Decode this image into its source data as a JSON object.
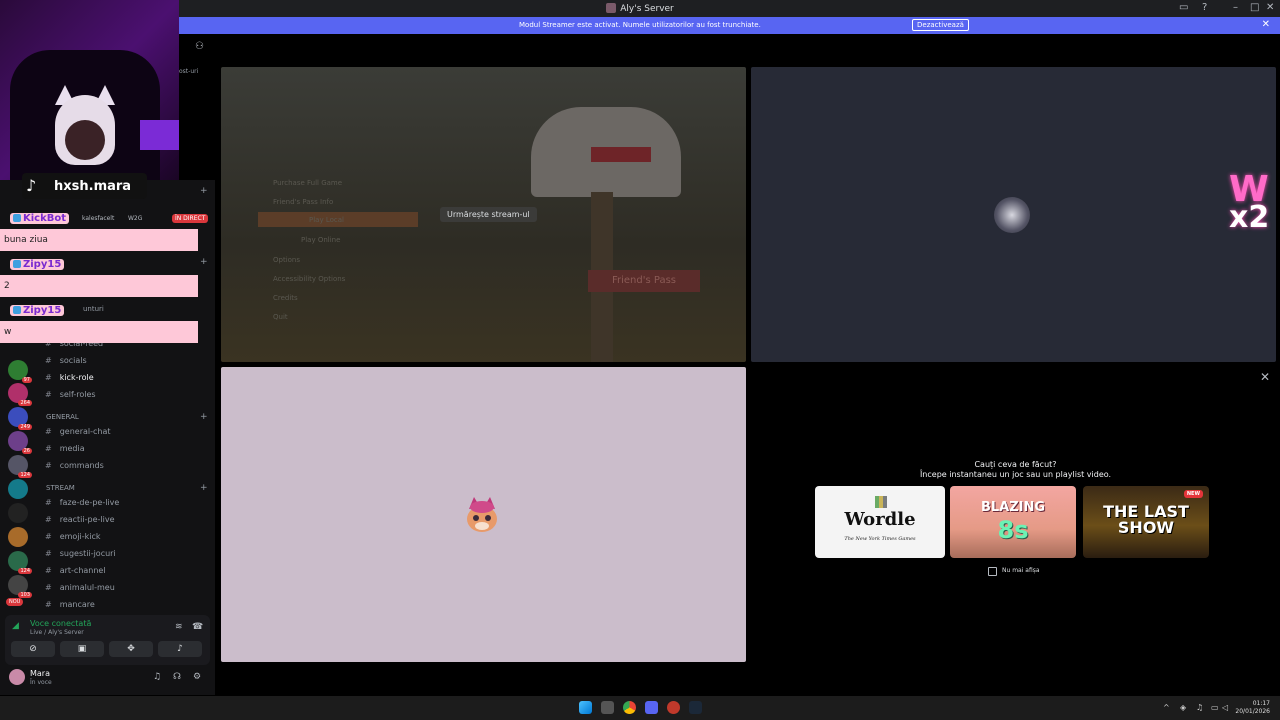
{
  "window": {
    "title": "Aly's Server"
  },
  "banner": {
    "text": "Modul Streamer este activat. Numele utilizatorilor au fost trunchiate.",
    "button": "Dezactivează"
  },
  "overlay": {
    "tiktok_handle": "hxsh.mara",
    "chat": [
      {
        "user": "KickBot",
        "message": "buna ziua"
      },
      {
        "user": "Zipy15",
        "message": "2"
      },
      {
        "user": "Zipy15",
        "message": "w"
      }
    ]
  },
  "sidebar": {
    "fragment_top": "ost-uri",
    "live_user": "kalesfacelt",
    "live_tag": "W2G",
    "live_badge": "ÎN DIRECT",
    "fragment_mid": "unturi",
    "channels_top": [
      {
        "name": "social-feed"
      },
      {
        "name": "socials"
      },
      {
        "name": "kick-role",
        "active": true
      },
      {
        "name": "self-roles"
      }
    ],
    "category_general": "GENERAL",
    "channels_general": [
      {
        "name": "general-chat"
      },
      {
        "name": "media"
      },
      {
        "name": "commands"
      }
    ],
    "category_stream": "STREAM",
    "channels_stream": [
      {
        "name": "faze-de-pe-live"
      },
      {
        "name": "reactii-pe-live"
      },
      {
        "name": "emoji-kick"
      },
      {
        "name": "sugestii-jocuri"
      },
      {
        "name": "art-channel"
      },
      {
        "name": "animalul-meu"
      },
      {
        "name": "mancare"
      }
    ],
    "server_badges": [
      "97",
      "264",
      "249",
      "26",
      "124",
      "124",
      "103",
      "NOU"
    ]
  },
  "voice": {
    "status": "Voce conectată",
    "channel": "Live / Aly's Server"
  },
  "user": {
    "name": "Mara",
    "status": "În voce"
  },
  "stage": {
    "watch_stream": "Urmărește stream-ul",
    "game_menu": [
      "Purchase Full Game",
      "Friend's Pass Info",
      "Play Local",
      "Play Online",
      "Options",
      "Accessibility Options",
      "Credits",
      "Quit"
    ],
    "game_title": "Friend's Pass",
    "overlay_w2": "W",
    "overlay_x2": "x2"
  },
  "activity": {
    "question": "Cauți ceva de făcut?",
    "subtitle": "Începe instantaneu un joc sau un playlist video.",
    "games": [
      {
        "title": "Wordle",
        "subtitle": "The New York Times Games"
      },
      {
        "title": "BLAZING",
        "subtitle": "8s"
      },
      {
        "title": "THE LAST SHOW",
        "badge": "NEW"
      }
    ],
    "dont_show": "Nu mai afișa"
  },
  "taskbar": {
    "time": "01:17",
    "date": "20/01/2026"
  }
}
